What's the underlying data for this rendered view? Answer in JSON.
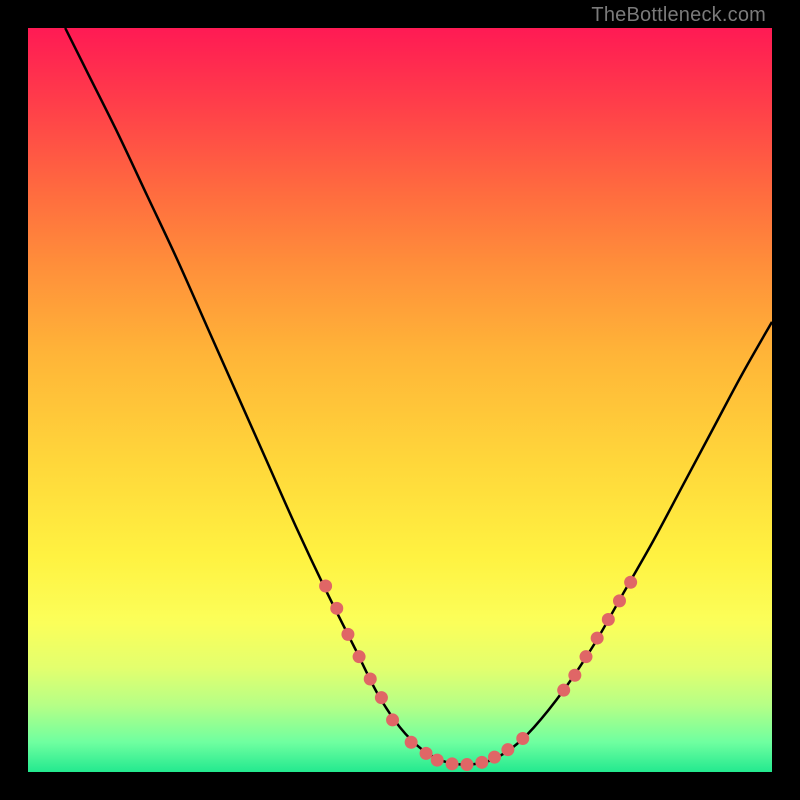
{
  "attribution": "TheBottleneck.com",
  "colors": {
    "background": "#000000",
    "gradient_top": "#ff1a54",
    "gradient_bottom": "#23e98f",
    "curve": "#000000",
    "marker": "#e06666",
    "attribution_text": "#7a7a7a"
  },
  "chart_data": {
    "type": "line",
    "title": "",
    "xlabel": "",
    "ylabel": "",
    "xlim": [
      0,
      100
    ],
    "ylim": [
      0,
      100
    ],
    "series": [
      {
        "name": "curve",
        "x": [
          5,
          8,
          12,
          16,
          20,
          24,
          28,
          32,
          36,
          40,
          44,
          47,
          50,
          53,
          56,
          59,
          62,
          65,
          68,
          72,
          76,
          80,
          84,
          88,
          92,
          96,
          100
        ],
        "y": [
          100,
          94,
          86,
          77.5,
          69,
          60,
          51,
          42,
          33,
          24.5,
          16.5,
          10.5,
          6,
          3,
          1.4,
          1,
          1.5,
          3.2,
          6,
          11,
          17,
          24,
          31,
          38.5,
          46,
          53.5,
          60.5
        ]
      }
    ],
    "markers": [
      {
        "x": 40.0,
        "y": 25.0
      },
      {
        "x": 41.5,
        "y": 22.0
      },
      {
        "x": 43.0,
        "y": 18.5
      },
      {
        "x": 44.5,
        "y": 15.5
      },
      {
        "x": 46.0,
        "y": 12.5
      },
      {
        "x": 47.5,
        "y": 10.0
      },
      {
        "x": 49.0,
        "y": 7.0
      },
      {
        "x": 51.5,
        "y": 4.0
      },
      {
        "x": 53.5,
        "y": 2.5
      },
      {
        "x": 55.0,
        "y": 1.6
      },
      {
        "x": 57.0,
        "y": 1.1
      },
      {
        "x": 59.0,
        "y": 1.0
      },
      {
        "x": 61.0,
        "y": 1.3
      },
      {
        "x": 62.7,
        "y": 2.0
      },
      {
        "x": 64.5,
        "y": 3.0
      },
      {
        "x": 66.5,
        "y": 4.5
      },
      {
        "x": 72.0,
        "y": 11.0
      },
      {
        "x": 73.5,
        "y": 13.0
      },
      {
        "x": 75.0,
        "y": 15.5
      },
      {
        "x": 76.5,
        "y": 18.0
      },
      {
        "x": 78.0,
        "y": 20.5
      },
      {
        "x": 79.5,
        "y": 23.0
      },
      {
        "x": 81.0,
        "y": 25.5
      }
    ]
  }
}
